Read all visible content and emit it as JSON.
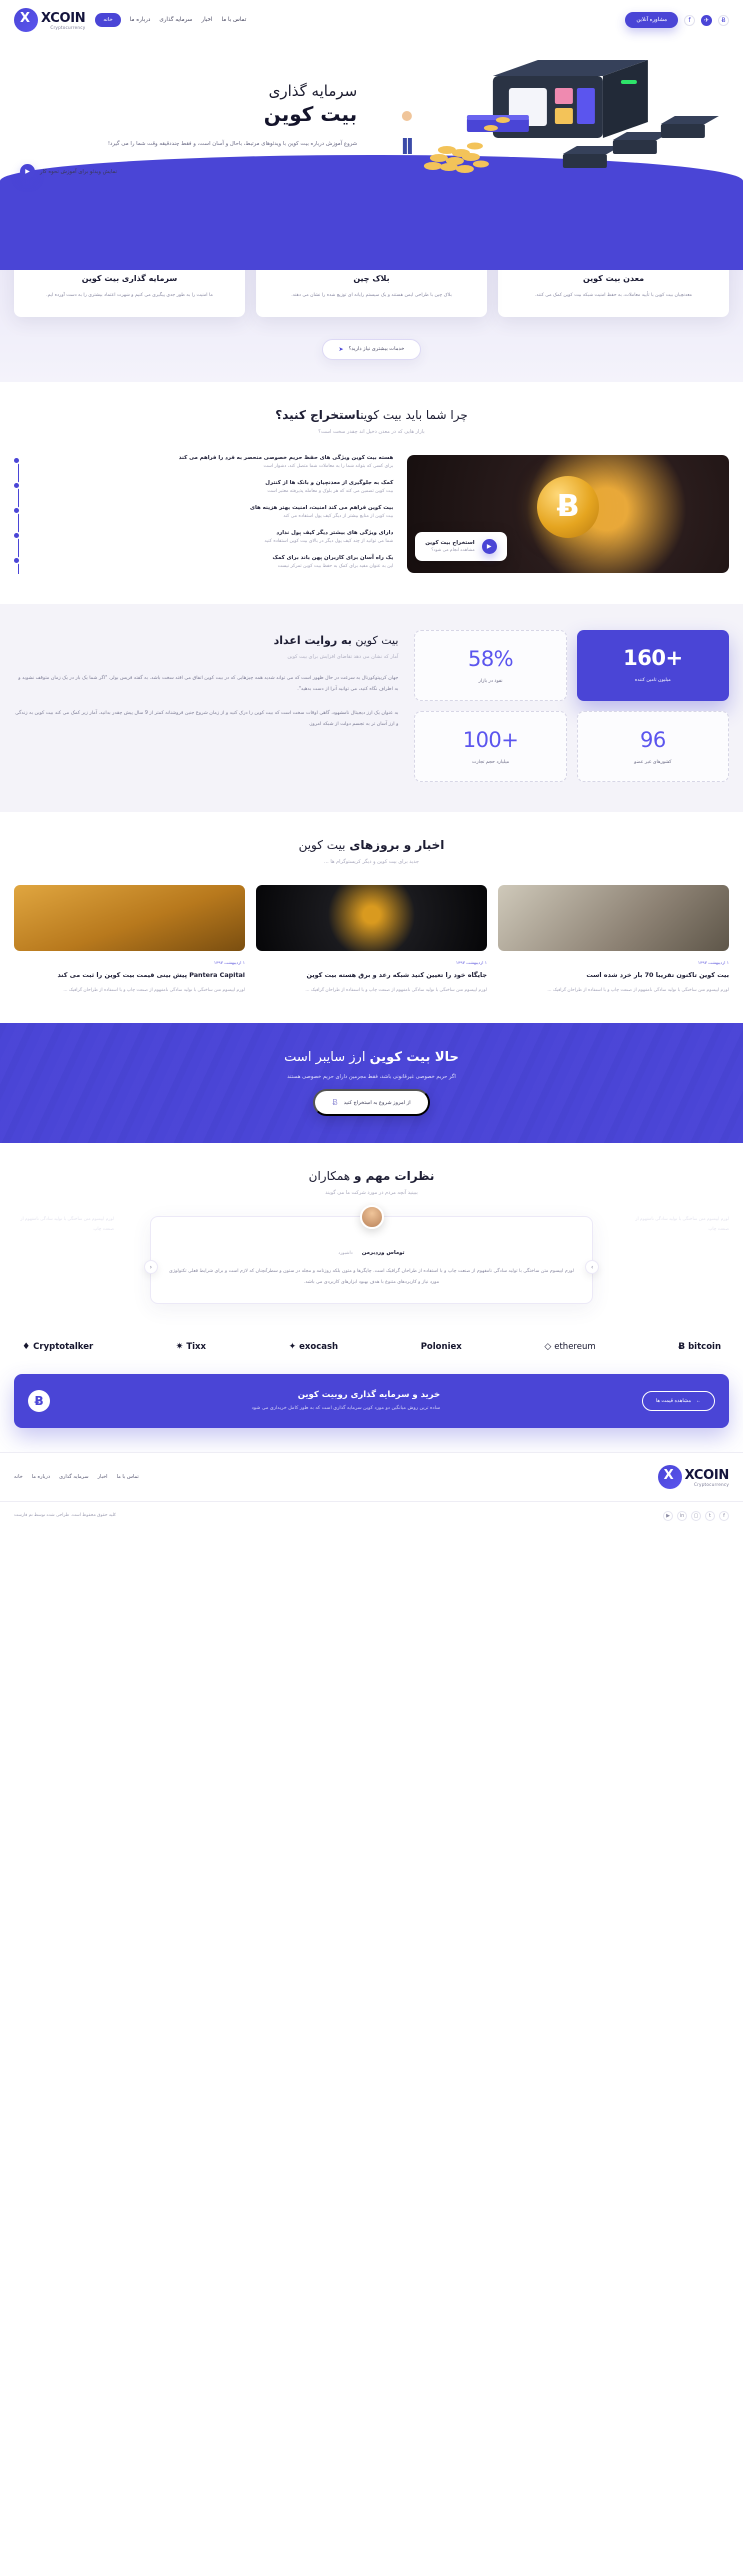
{
  "brand": {
    "name": "XCOIN",
    "tagline": "Cryptocurrency",
    "mark": "X"
  },
  "header": {
    "nav": [
      {
        "label": "خانه",
        "active": true
      },
      {
        "label": "درباره ما",
        "active": false
      },
      {
        "label": "سرمایه گذاری",
        "active": false
      },
      {
        "label": "اخبار",
        "active": false
      },
      {
        "label": "تماس با ما",
        "active": false
      }
    ],
    "consult_button": "مشاوره آنلاین",
    "social": [
      {
        "name": "bitcoin-icon",
        "glyph": "Ƀ"
      },
      {
        "name": "twitter-icon",
        "glyph": "✉"
      },
      {
        "name": "facebook-icon",
        "glyph": "f"
      }
    ]
  },
  "hero": {
    "eyebrow": "سرمایه گذاری",
    "title": "بیت کوین",
    "paragraph": "شروع آموزش درباره بیت کوین با ویدئوهای مرتبط، باحال و آسان است، و فقط چنددقیقه وقت شما را می گیرد!",
    "cta": "نمایش ویدئو برای آموزش نحوه کار",
    "play_icon": "play-icon"
  },
  "features": {
    "cards": [
      {
        "icon": "bitcoin-exchange-icon",
        "title": "سرمایه گذاری بیت کوین",
        "text": "ما امنیت را به طور جدی پیگیری می کنیم و شهرت اعتماد بیشتری را به دست آورده ایم."
      },
      {
        "icon": "blockchain-network-icon",
        "title": "بلاک چین",
        "text": "بلاک چین با طراحی ایمن هستند و یک سیستم رایانه ای توزیع شده را نشان می دهند."
      },
      {
        "icon": "bitcoin-mining-pickaxe-icon",
        "title": "معدن بیت کوین",
        "text": "معدنچیان بیت کوین با تأیید معاملات، به حفظ امنیت شبکه بیت کوین کمک می کنند."
      }
    ],
    "more_button": "خدمات بیشتری نیاز دارید؟",
    "more_icon": "rocket-icon"
  },
  "why": {
    "title_plain": "چرا شما باید بیت کوین",
    "title_bold": "استخراج کنید؟",
    "subtitle": "بازار هایی که در معدن دخیل اند چقدر سخت است؟",
    "items": [
      {
        "title": "هسته بیت کوین ویژگی های حفظ حریم خصوصی منحصر به فرد را فراهم می کند",
        "text": "برای کسی که بتواند شما را به معاملات شما متصل کند، دشوار است"
      },
      {
        "title": "کمک به جلوگیری از معدنچیان و بانک ها از کنترل",
        "text": "بیت کوین تضمین می کند که هر بلوک و معامله پذیرفته معتبر است"
      },
      {
        "title": "بیت کوین فراهم می کند امنیت، امنیت بهتر هزینه های",
        "text": "بیت کوین از منابع بیشتر از دیگر کیف پول استفاده می کند"
      },
      {
        "title": "دارای ویژگی های بیشتر دیگر کیف پول ندارد",
        "text": "شما می توانید از چند کیف پول دیگر در بالای بیت کوین استفاده کنید"
      },
      {
        "title": "یک راه آسان برای کاربران پهن باند برای کمک",
        "text": "این به عنوان مفید برای کمک به حفظ بیت کوین تمرکز نیست"
      }
    ],
    "video": {
      "title": "استخراج بیت کوین",
      "subtitle": "مشاهده انجام می شود؟",
      "icon": "play-icon"
    }
  },
  "stats": {
    "title_plain": "بیت کوین",
    "title_bold": "به روایت اعداد",
    "subtitle": "آمار که نشان می دهد تقاضای افزایش برای بیت کوین",
    "paragraph_1": "جهان کریپتوکورنال به سرعت در حال ظهور است که می تواند شدید همه چیزهایی که در بیت کوین اتفاق می افتد سخت باشد. به گفته فریس بولر، \"اگر شما یک بار در یک زمان متوقف نشوید و به اطراف نگاه کنید، می توانید آنرا از دست بدهید\".",
    "paragraph_2": "به عنوان یک ارز دیجیتال نامشهود، گاهی اوقات سخت است که بیت کوین را درک کنید و از زمان شروع جنین فروشنانه کمتر از 9 سال پیش چقدر بدانید. آمار زیر کمک می کند بیت کوین به زندگی و ارز آسان تر به تجسم دولت از شبکه امروز.",
    "items": [
      {
        "value": "58%",
        "label": "نفوذ در بازار",
        "highlight": false
      },
      {
        "value": "+160",
        "label": "میلیون تامین کننده",
        "highlight": true
      },
      {
        "value": "+100",
        "label": "میلیارد حجم تجارت",
        "highlight": false
      },
      {
        "value": "96",
        "label": "کشورهای غیر عضو",
        "highlight": false
      }
    ]
  },
  "news": {
    "title_bold": "اخبار و بروزهای",
    "title_plain": "بیت کوین",
    "subtitle": "جدید برای بیت کوین و دیگر کریستوگرام ها ...",
    "articles": [
      {
        "date": "۱ اردیبهشت ۱۳۹۷",
        "title": "بیت کوین تاکنون تقریبا 70 بار خرد شده است",
        "excerpt": "لورم ایپسوم متن ساختگی با تولید سادگی نامفهوم از صنعت چاپ و با استفاده از طراحان گرافیک ...",
        "thumb": "cash-in-hands-photo"
      },
      {
        "date": "۱ اردیبهشت ۱۳۹۷",
        "title": "جایگاه خود را تعیین کنید شبکه رعد و برق هسته بیت کوین",
        "excerpt": "لورم ایپسوم متن ساختگی با تولید سادگی نامفهوم از صنعت چاپ و با استفاده از طراحان گرافیک ...",
        "thumb": "gold-coin-dark-photo"
      },
      {
        "date": "۱ اردیبهشت ۱۳۹۷",
        "title": "Pantera Capital پیش بینی قیمت بیت کوین را ثبت می کند",
        "excerpt": "لورم ایپسوم متن ساختگی با تولید سادگی نامفهوم از صنعت چاپ و با استفاده از طراحان گرافیک ...",
        "thumb": "bitcoin-coins-photo"
      }
    ]
  },
  "banner": {
    "title_bold": "حالا بیت کوین",
    "title_plain2": "ارز سایبر است",
    "subtitle": "اگر حریم خصوصی غیرقانونی باشد، فقط مجرمین دارای حریم خصوصی هستند",
    "button": "از امروز شروع به استخراج کنید",
    "button_icon": "bitcoin-icon"
  },
  "testimonials": {
    "title_bold": "نظرات مهم و",
    "title_plain": "همکاران",
    "subtitle": "ببینید آنچه مردم در مورد شرکت ما می گویند",
    "author": "توماس وردبرمن",
    "role": "داشبورد",
    "quote": "لورم ایپسوم متن ساختگی با تولید سادگی نامفهوم از صنعت چاپ و با استفاده از طراحان گرافیک است. چاپگرها و متون بلکه روزنامه و مجله در ستون و سطرآنچنان که لازم است و برای شرایط فعلی تکنولوژی مورد نیاز و کاربردهای متنوع با هدف بهبود ابزارهای کاربردی می باشد.",
    "prev_icon": "chevron-right-icon",
    "next_icon": "chevron-left-icon",
    "ghost_left": "لورم ایپسوم متن ساختگی با تولید سادگی نامفهوم از صنعت چاپ",
    "ghost_right": "لورم ایپسوم متن ساختگی با تولید سادگی نامفهوم از صنعت چاپ"
  },
  "partners": [
    {
      "name": "Cryptotalker",
      "icon": "leaf-icon"
    },
    {
      "name": "Tixx",
      "icon": "star-icon"
    },
    {
      "name": "exocash",
      "icon": "diamond-icon"
    },
    {
      "name": "Poloniex",
      "icon": "none"
    },
    {
      "name": "ethereum",
      "icon": "ethereum-icon"
    },
    {
      "name": "bitcoin",
      "icon": "bitcoin-icon"
    }
  ],
  "cta_box": {
    "title": "خرید و سرمایه گذاری روبیت کوین",
    "subtitle": "ساده ترین روش میانگین دو مورد کوین سرمایه گذاری است که به طور کامل خریداری می شود",
    "button": "مشاهده قیمت ها",
    "button_icon": "arrow-left-icon",
    "badge_icon": "bitcoin-icon"
  },
  "footer": {
    "nav": [
      {
        "label": "خانه"
      },
      {
        "label": "درباره ما"
      },
      {
        "label": "سرمایه گذاری"
      },
      {
        "label": "اخبار"
      },
      {
        "label": "تماس با ما"
      }
    ],
    "copyright": "کلیه حقوق محفوظ است. طراحی شده توسط تم فارست",
    "social": [
      {
        "name": "facebook-icon",
        "glyph": "f"
      },
      {
        "name": "twitter-icon",
        "glyph": "t"
      },
      {
        "name": "instagram-icon",
        "glyph": "▢"
      },
      {
        "name": "linkedin-icon",
        "glyph": "in"
      },
      {
        "name": "youtube-icon",
        "glyph": "▶"
      }
    ]
  },
  "colors": {
    "accent": "#4a45d6",
    "accent_light": "#5b55ee",
    "dark": "#14142b",
    "gold": "#e5a520"
  }
}
